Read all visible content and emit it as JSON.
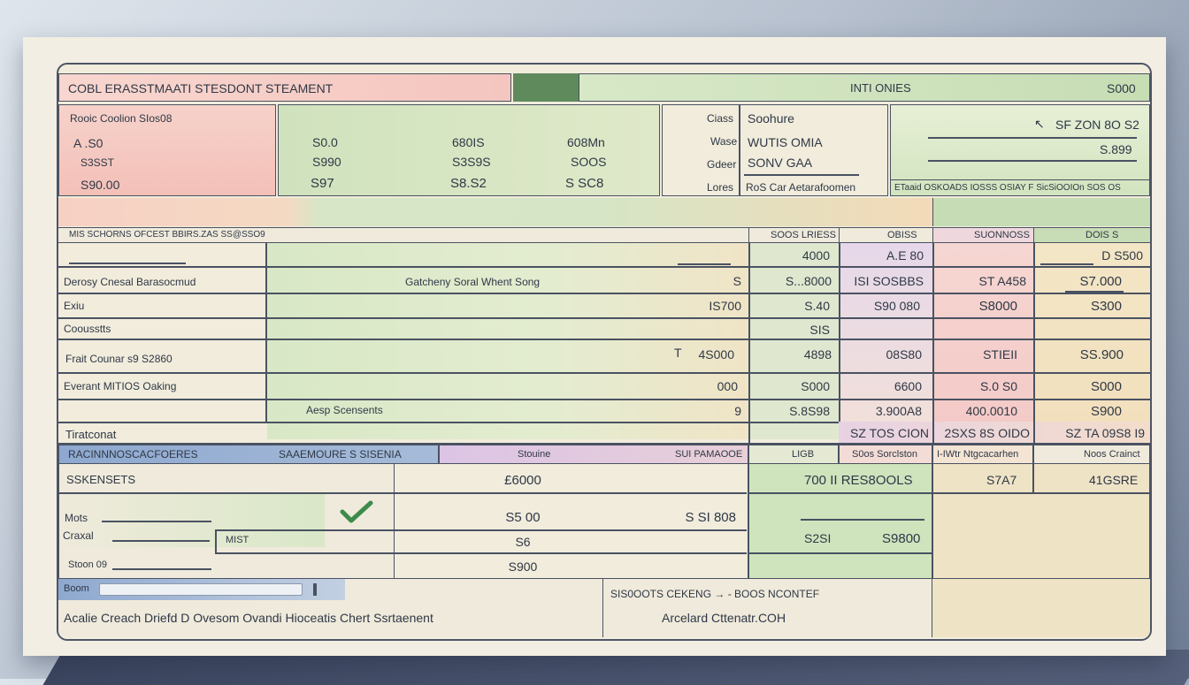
{
  "header": {
    "title": "COBL ERASSTMAATI STESDONT STEAMENT",
    "right_label": "INTI ONIES",
    "right_value": "S000"
  },
  "info_block": {
    "label": "Rooic Coolion SIos08",
    "values": [
      "A .S0",
      "S3SST",
      "S90.00"
    ]
  },
  "amounts_block": {
    "col1": [
      "S0.0",
      "S990",
      "S97"
    ],
    "col2": [
      "680IS",
      "S3S9S",
      "S8.S2"
    ],
    "col3": [
      "608Mn",
      "SOOS",
      "S SC8"
    ]
  },
  "contact_block": {
    "labels": [
      "Ciass",
      "Wase",
      "Gdeer",
      "Lores"
    ],
    "values": [
      "Soohure",
      "WUTIS OMIA",
      "SONV GAA",
      "RoS Car Aetarafoomen"
    ]
  },
  "summary_block": {
    "value1": "SF ZON 8O S2",
    "value2": "S.899",
    "footer": "ETaaid OSKOADS IOSSS OSIAY F SicSiOOIOn SOS OS"
  },
  "table": {
    "title_row": "MIS SCHORNS OFCEST BBIRS.ZAS SS@SSO9",
    "headers": [
      "SOOS LRIESS",
      "OBISS",
      "SUONNOSS",
      "DOIS S"
    ],
    "rows": [
      {
        "label": "",
        "desc": "",
        "amount": "",
        "c1": "4000",
        "c2": "A.E 80",
        "c3": "",
        "c4": "D S500"
      },
      {
        "label": "Derosy Cnesal Barasocmud",
        "desc": "Gatcheny Soral Whent Song",
        "amount": "S",
        "c1": "S...8000",
        "c2": "ISI   SOSBBS",
        "c3": "ST A458",
        "c4": "S7.000"
      },
      {
        "label": "Exiu",
        "desc": "",
        "amount": "IS700",
        "c1": "S.40",
        "c2": "S90 080",
        "c3": "S8000",
        "c4": "S300"
      },
      {
        "label": "Coousstts",
        "desc": "",
        "amount": "",
        "c1": "SIS",
        "c2": "",
        "c3": "",
        "c4": ""
      },
      {
        "label": "Frait Counar s9 S2860",
        "desc": "T",
        "amount": "4S000",
        "c1": "4898",
        "c2": "08S80",
        "c3": "STIEII",
        "c4": "SS.900"
      },
      {
        "label": "Everant MITIOS Oaking",
        "desc": "",
        "amount": "000",
        "c1": "S000",
        "c2": "6600",
        "c3": "S.0 S0",
        "c4": "S000"
      },
      {
        "label": "",
        "desc": "Aesp Scensents",
        "amount": "9",
        "c1": "S.8S98",
        "c2": "3.900A8",
        "c3": "400.0010",
        "c4": "S900"
      },
      {
        "label": "Tiratconat",
        "desc": "",
        "amount": "",
        "c1": "",
        "c2": "SZ TOS CION",
        "c3": "2SXS 8S OIDO",
        "c4": "SZ TA 09S8 I9"
      }
    ]
  },
  "sub_headers": {
    "left": "RACINNNOSCACFOERES",
    "left2": "SAAEMOURE  S SISENIA",
    "mid": "Stouine",
    "mid2": "SUI PAMAOOE",
    "c1": "LIGB",
    "c2": "S0os Sorclston",
    "c3": "I-IWtr Ntgcacarhen",
    "c4": "Noos Crainct"
  },
  "lower": {
    "row1_label": "SSKENSETS",
    "row1_value": "£6000",
    "row1_c1": "700  II   RES8OOLS",
    "row1_c3": "S7A7",
    "row1_c4": "41GSRE",
    "labels": [
      "Mots",
      "Craxal",
      "Stoon 09"
    ],
    "mid_label": "MIST",
    "vals_a": [
      "S5 00",
      "S6",
      "S900"
    ],
    "val_b": "S SI 808",
    "box_a": "S2SI",
    "box_b": "S9800"
  },
  "footer": {
    "input_label": "Boom",
    "bottom_text": "Acalie Creach Driefd D Ovesom Ovandi Hioceatis Chert Ssrtaenent",
    "right_top": "SIS0OOTS   CEKENG  →  -  BOOS     NCONTEF",
    "right_bottom": "Arcelard Cttenatr.COH"
  },
  "colors": {
    "pink": "#f6c9c2",
    "green": "#c9dfb7",
    "peach": "#f7dcb8",
    "blue": "#8aa5c9",
    "lavender": "#dcc6e6"
  }
}
